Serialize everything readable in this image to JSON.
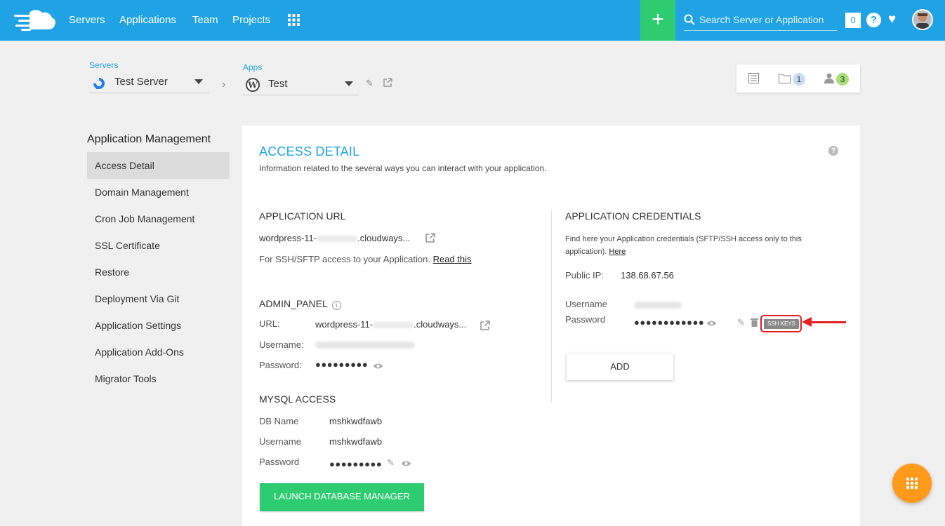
{
  "colors": {
    "primary": "#1fa3e4",
    "green": "#2ecc71",
    "orange": "#ff9a1a",
    "red": "#e02020"
  },
  "topbar": {
    "nav": [
      "Servers",
      "Applications",
      "Team",
      "Projects"
    ],
    "search_placeholder": "Search Server or Application",
    "notifications": "0"
  },
  "breadcrumb": {
    "servers_label": "Servers",
    "server_name": "Test Server",
    "apps_label": "Apps",
    "app_name": "Test"
  },
  "quickbox": {
    "folder_count": "1",
    "users_count": "3"
  },
  "sidebar": {
    "title": "Application Management",
    "items": [
      "Access Detail",
      "Domain Management",
      "Cron Job Management",
      "SSL Certificate",
      "Restore",
      "Deployment Via Git",
      "Application Settings",
      "Application Add-Ons",
      "Migrator Tools"
    ]
  },
  "card": {
    "title": "ACCESS DETAIL",
    "subtitle": "Information related to the several ways you can interact with your application.",
    "app_url": {
      "heading": "APPLICATION URL",
      "url_prefix": "wordpress-11-",
      "url_suffix": ".cloudways...",
      "ssh_note": "For SSH/SFTP access to your Application.",
      "read_this": "Read this"
    },
    "admin_panel": {
      "heading": "ADMIN_PANEL",
      "url_label": "URL:",
      "url_prefix": "wordpress-11-",
      "url_suffix": ".cloudways...",
      "username_label": "Username:",
      "password_label": "Password:",
      "password_mask": "●●●●●●●●●"
    },
    "mysql": {
      "heading": "MYSQL ACCESS",
      "db_name_label": "DB Name",
      "db_name": "mshkwdfawb",
      "username_label": "Username",
      "username": "mshkwdfawb",
      "password_label": "Password",
      "password_mask": "●●●●●●●●●",
      "launch_button": "LAUNCH DATABASE MANAGER"
    },
    "credentials": {
      "heading": "APPLICATION CREDENTIALS",
      "note": "Find here your Application credentials (SFTP/SSH access only to this application).",
      "here": "Here",
      "public_ip_label": "Public IP:",
      "public_ip": "138.68.67.56",
      "username_label": "Username",
      "password_label": "Password",
      "password_mask": "●●●●●●●●●●●●",
      "ssh_keys": "SSH KEYS",
      "add_button": "ADD"
    }
  }
}
